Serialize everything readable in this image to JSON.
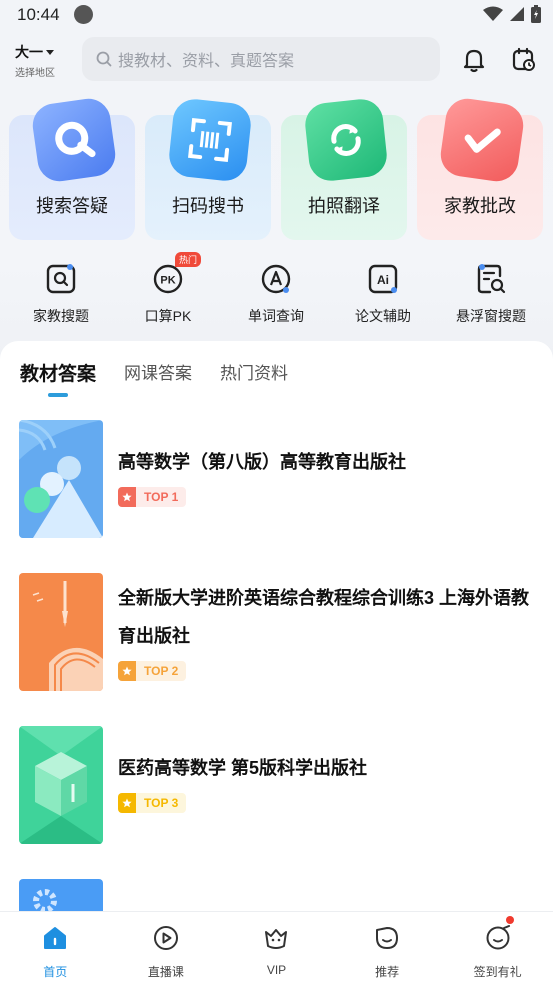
{
  "status": {
    "time": "10:44"
  },
  "header": {
    "region_name": "大一",
    "region_sub": "选择地区",
    "search_placeholder": "搜教材、资料、真题答案"
  },
  "features": [
    {
      "label": "搜索答疑",
      "icon": "search-q-icon"
    },
    {
      "label": "扫码搜书",
      "icon": "scan-book-icon"
    },
    {
      "label": "拍照翻译",
      "icon": "photo-translate-icon"
    },
    {
      "label": "家教批改",
      "icon": "check-correct-icon"
    }
  ],
  "tools": [
    {
      "label": "家教搜题",
      "icon": "tutor-search-icon"
    },
    {
      "label": "口算PK",
      "icon": "pk-icon",
      "badge": "热门"
    },
    {
      "label": "单词查询",
      "icon": "word-query-icon"
    },
    {
      "label": "论文辅助",
      "icon": "ai-paper-icon"
    },
    {
      "label": "悬浮窗搜题",
      "icon": "float-window-search-icon"
    }
  ],
  "tabs": [
    {
      "label": "教材答案",
      "active": true
    },
    {
      "label": "网课答案",
      "active": false
    },
    {
      "label": "热门资料",
      "active": false
    }
  ],
  "books": [
    {
      "title": "高等数学（第八版）高等教育出版社",
      "rank": "TOP 1",
      "rank_color": "#f26b5b"
    },
    {
      "title": "全新版大学进阶英语综合教程综合训练3 上海外语教育出版社",
      "rank": "TOP 2",
      "rank_color": "#f5a33a"
    },
    {
      "title": "医药高等数学 第5版科学出版社",
      "rank": "TOP 3",
      "rank_color": "#f5b800"
    }
  ],
  "bottom_nav": [
    {
      "label": "首页",
      "active": true
    },
    {
      "label": "直播课",
      "active": false
    },
    {
      "label": "VIP",
      "active": false
    },
    {
      "label": "推荐",
      "active": false
    },
    {
      "label": "签到有礼",
      "active": false
    }
  ],
  "colors": {
    "accent": "#1e8fe0",
    "badge_red": "#f04a3a"
  }
}
